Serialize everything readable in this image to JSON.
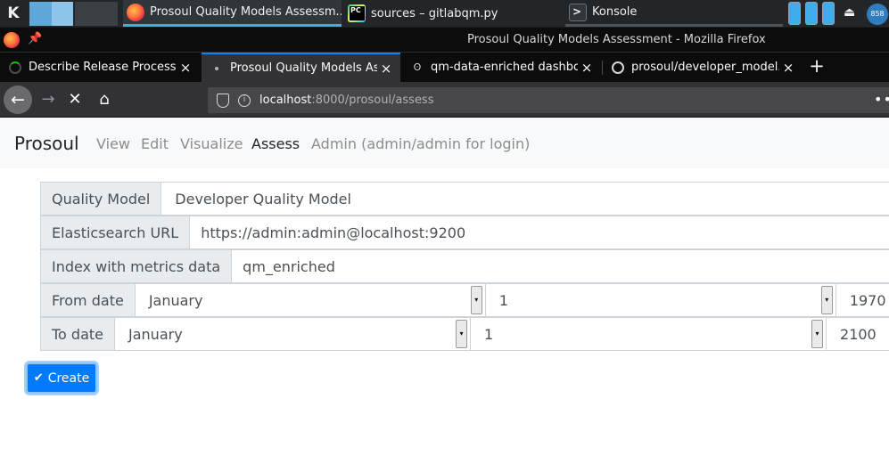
{
  "taskbar": {
    "tasks": [
      {
        "label": "Prosoul Quality Models Assessm...",
        "icon": "firefox-icon"
      },
      {
        "label": "sources – gitlabqm.py",
        "icon": "pycharm-icon"
      },
      {
        "label": "Konsole",
        "icon": "konsole-icon"
      }
    ],
    "avatar_text": "858"
  },
  "window": {
    "title": "Prosoul Quality Models Assessment - Mozilla Firefox"
  },
  "tabs": [
    {
      "label": "Describe Release Process",
      "close": "×"
    },
    {
      "label": "Prosoul Quality Models As",
      "close": "×"
    },
    {
      "label": "qm-data-enriched dashbo",
      "close": "×"
    },
    {
      "label": "prosoul/developer_model.",
      "close": "×"
    }
  ],
  "newtab_label": "+",
  "urlbar": {
    "host": "localhost",
    "path": ":8000/prosoul/assess"
  },
  "navbar_icons": {
    "back": "←",
    "forward": "→",
    "stop": "✕",
    "home": "⌂",
    "overflow": "•••"
  },
  "app": {
    "brand": "Prosoul",
    "nav": [
      "View",
      "Edit",
      "Visualize",
      "Assess",
      "Admin (admin/admin for login)"
    ],
    "active_nav": "Assess"
  },
  "form": {
    "quality_model": {
      "label": "Quality Model",
      "value": "Developer Quality Model"
    },
    "es_url": {
      "label": "Elasticsearch URL",
      "value": "https://admin:admin@localhost:9200"
    },
    "index": {
      "label": "Index with metrics data",
      "value": "qm_enriched"
    },
    "from_date": {
      "label": "From date",
      "month": "January",
      "day": "1",
      "year": "1970"
    },
    "to_date": {
      "label": "To date",
      "month": "January",
      "day": "1",
      "year": "2100"
    }
  },
  "create_button": {
    "label": "Create",
    "icon": "check-icon"
  },
  "colors": {
    "primary": "#007bff",
    "tab_highlight": "#0a84ff",
    "kde_accent": "#3daee9"
  }
}
